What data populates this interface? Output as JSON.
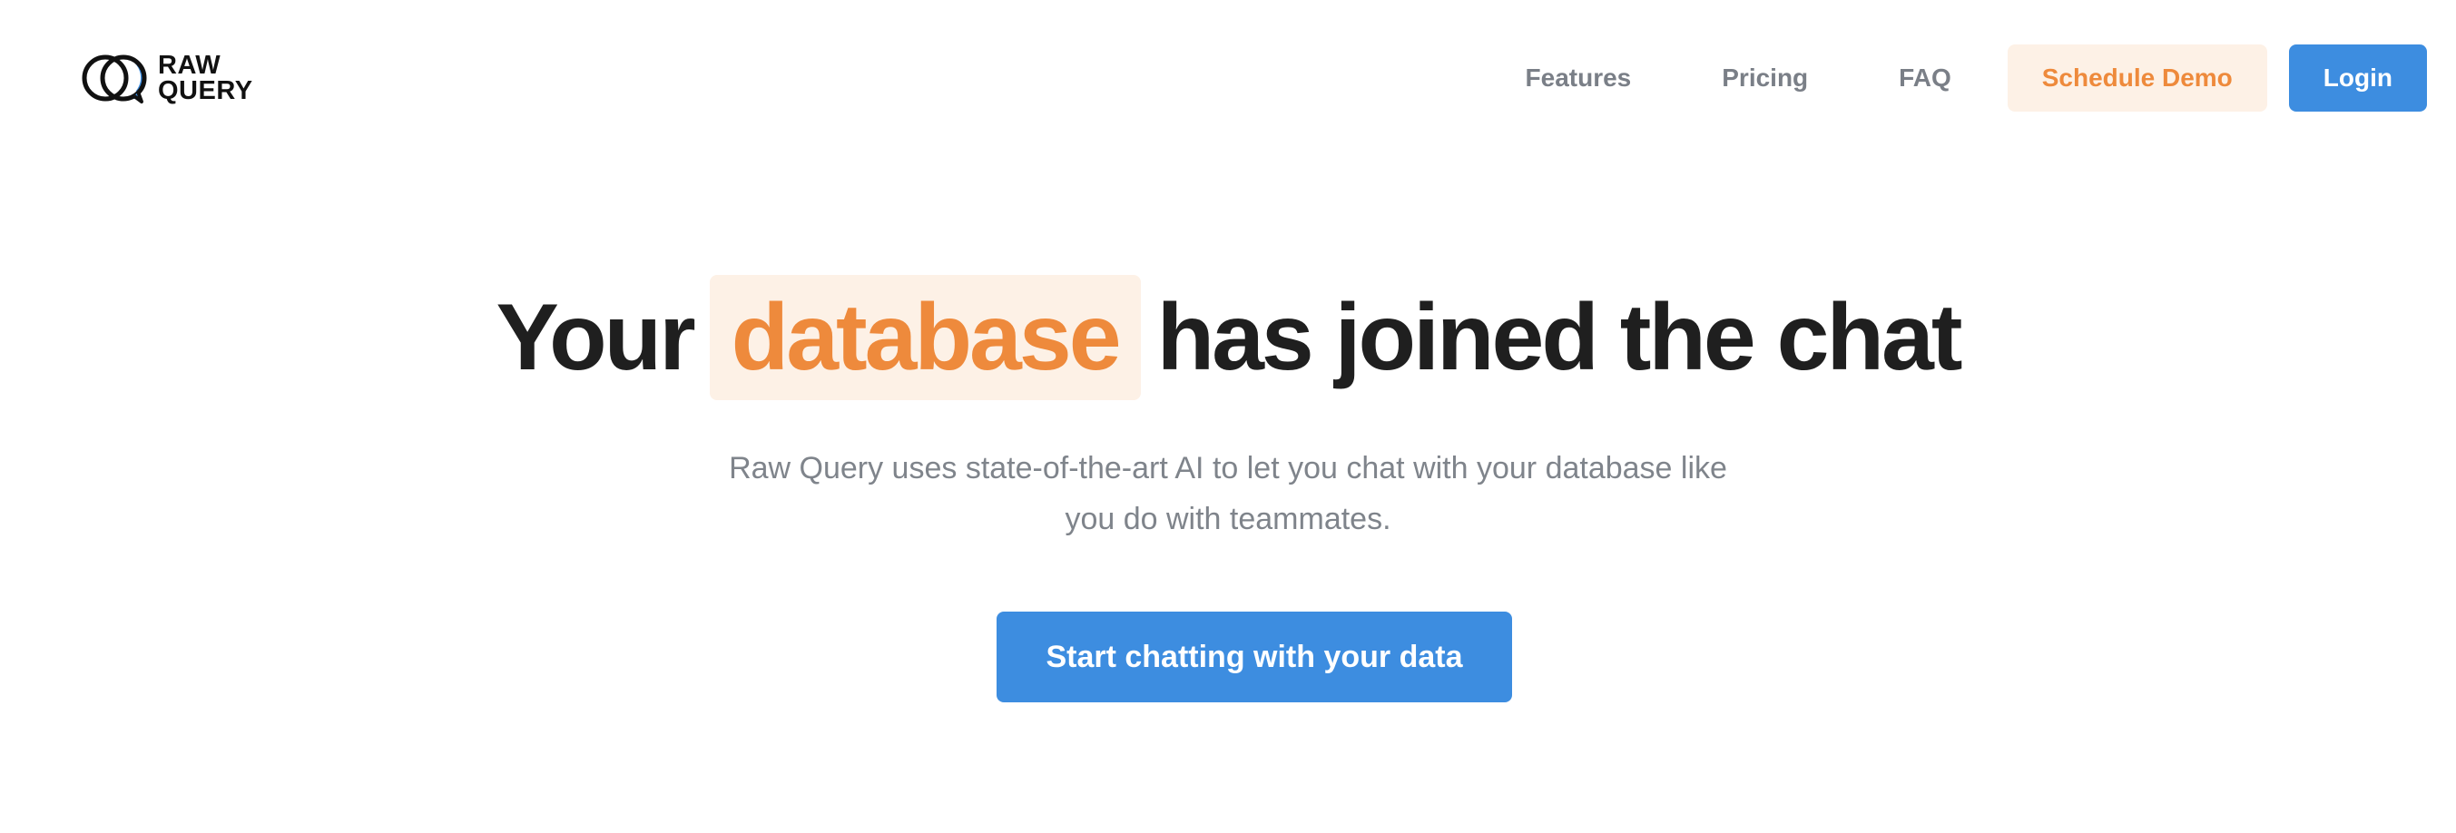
{
  "logo": {
    "line1": "RAW",
    "line2": "QUERY",
    "icon": "chat-bubbles-icon"
  },
  "nav": {
    "features": "Features",
    "pricing": "Pricing",
    "faq": "FAQ",
    "schedule_demo": "Schedule Demo",
    "login": "Login"
  },
  "hero": {
    "title_before": "Your",
    "title_highlight": "database",
    "title_after": "has joined the chat",
    "subtitle_line1": "Raw Query uses state-of-the-art AI to let you chat with your database like",
    "subtitle_line2": "you do with teammates.",
    "cta": "Start chatting with your data"
  },
  "colors": {
    "accent_blue": "#3d8de0",
    "accent_orange": "#ee8a3c",
    "highlight_bg": "#fdf1e6",
    "heading": "#1f1f1f",
    "muted_text": "#7f848b"
  }
}
